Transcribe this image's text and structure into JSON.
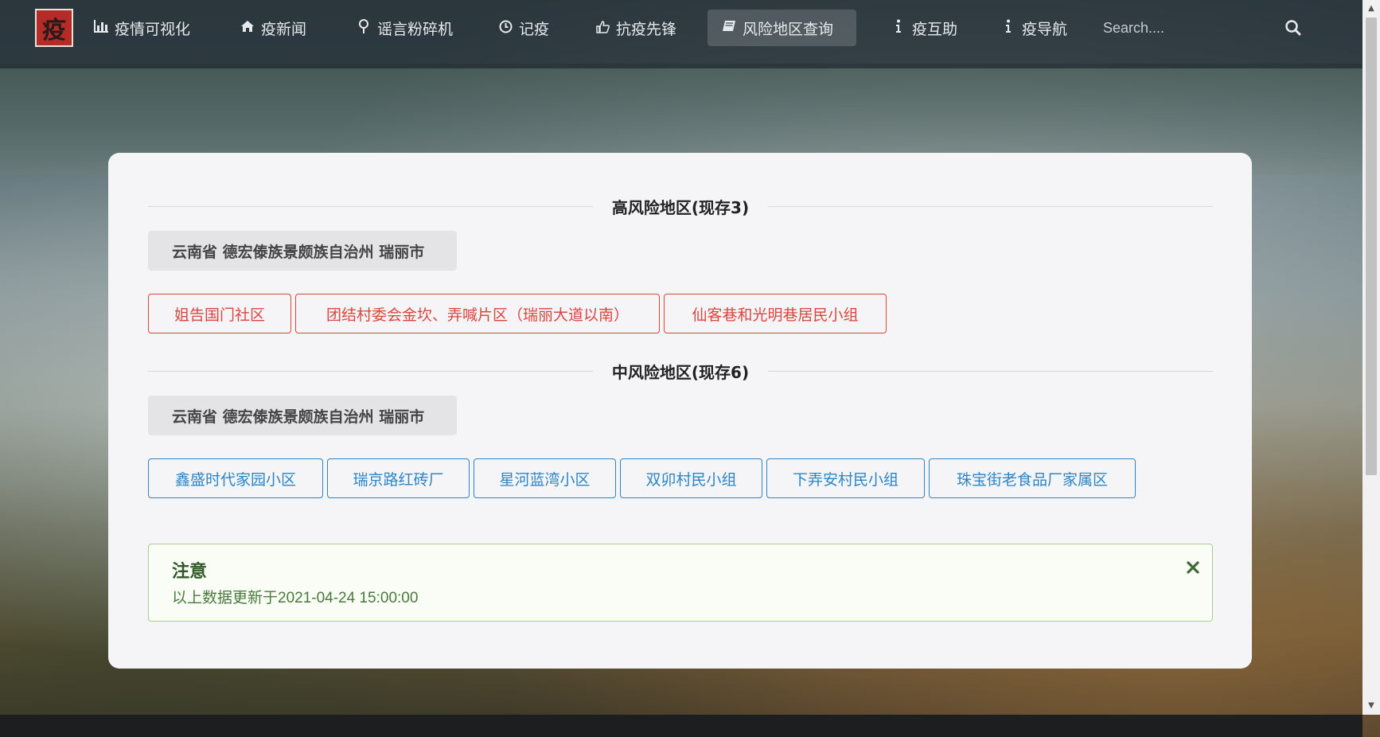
{
  "nav": {
    "logo_char": "疫",
    "items": [
      {
        "icon": "bar-chart-icon",
        "label": "疫情可视化"
      },
      {
        "icon": "home-icon",
        "label": "疫新闻"
      },
      {
        "icon": "map-pin-icon",
        "label": "谣言粉碎机"
      },
      {
        "icon": "clock-icon",
        "label": "记疫"
      },
      {
        "icon": "thumbs-up-icon",
        "label": "抗疫先锋"
      },
      {
        "icon": "book-icon",
        "label": "风险地区查询",
        "active": true
      },
      {
        "icon": "info-icon",
        "label": "疫互助"
      },
      {
        "icon": "info-icon",
        "label": "疫导航"
      }
    ],
    "search_placeholder": "Search...."
  },
  "high_risk": {
    "title": "高风险地区(现存3)",
    "region": "云南省 德宏傣族景颇族自治州 瑞丽市",
    "areas": [
      "姐告国门社区",
      "团结村委会金坎、弄喊片区（瑞丽大道以南）",
      "仙客巷和光明巷居民小组"
    ],
    "color": "#d9453f"
  },
  "mid_risk": {
    "title": "中风险地区(现存6)",
    "region": "云南省 德宏傣族景颇族自治州 瑞丽市",
    "areas": [
      "鑫盛时代家园小区",
      "瑞京路红砖厂",
      "星河蓝湾小区",
      "双卯村民小组",
      "下弄安村民小组",
      "珠宝街老食品厂家属区"
    ],
    "color": "#2b85c6"
  },
  "notice": {
    "title": "注意",
    "text": "以上数据更新于2021-04-24 15:00:00"
  }
}
